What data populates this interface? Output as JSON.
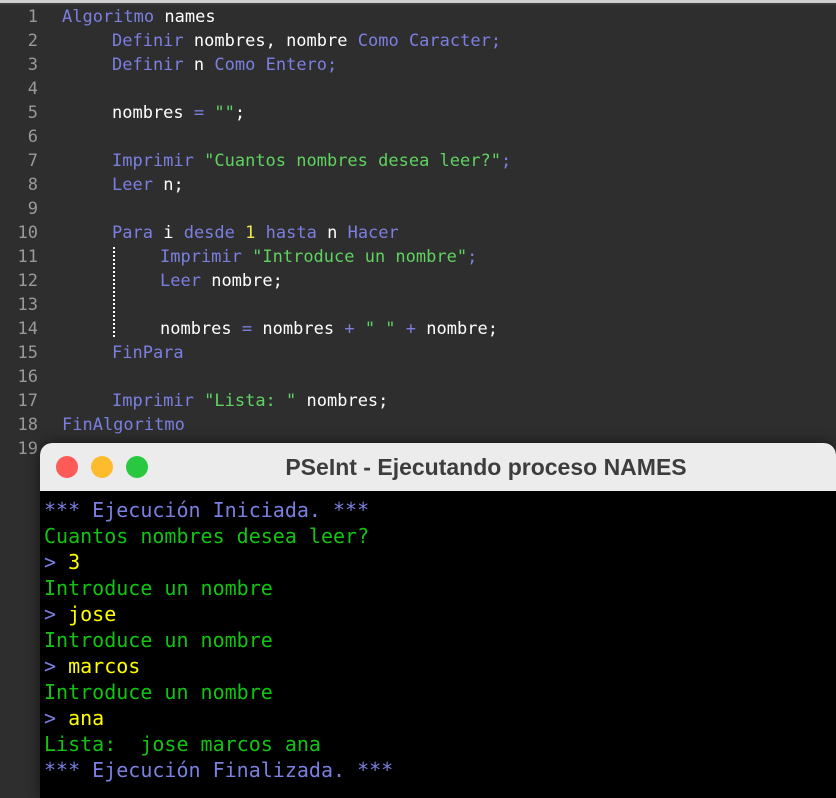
{
  "editor": {
    "name": "pseint-code-editor",
    "language": "PSeInt",
    "line_count_visible": 19,
    "lines": [
      {
        "n": "1",
        "tokens": [
          {
            "t": "Algoritmo",
            "c": "kw"
          },
          {
            "t": " ",
            "c": "id"
          },
          {
            "t": "names",
            "c": "id"
          }
        ],
        "indent": 0
      },
      {
        "n": "2",
        "tokens": [
          {
            "t": "Definir",
            "c": "kw"
          },
          {
            "t": " ",
            "c": "id"
          },
          {
            "t": "nombres",
            "c": "id"
          },
          {
            "t": ",",
            "c": "id"
          },
          {
            "t": " ",
            "c": "id"
          },
          {
            "t": "nombre",
            "c": "id"
          },
          {
            "t": " ",
            "c": "id"
          },
          {
            "t": "Como",
            "c": "kw"
          },
          {
            "t": " ",
            "c": "id"
          },
          {
            "t": "Caracter",
            "c": "kw"
          },
          {
            "t": ";",
            "c": "kw"
          }
        ],
        "indent": 1
      },
      {
        "n": "3",
        "tokens": [
          {
            "t": "Definir",
            "c": "kw"
          },
          {
            "t": " ",
            "c": "id"
          },
          {
            "t": "n",
            "c": "id"
          },
          {
            "t": " ",
            "c": "id"
          },
          {
            "t": "Como",
            "c": "kw"
          },
          {
            "t": " ",
            "c": "id"
          },
          {
            "t": "Entero",
            "c": "kw"
          },
          {
            "t": ";",
            "c": "kw"
          }
        ],
        "indent": 1
      },
      {
        "n": "4",
        "tokens": [],
        "indent": 1
      },
      {
        "n": "5",
        "tokens": [
          {
            "t": "nombres",
            "c": "id"
          },
          {
            "t": " ",
            "c": "id"
          },
          {
            "t": "=",
            "c": "op"
          },
          {
            "t": " ",
            "c": "id"
          },
          {
            "t": "\"\"",
            "c": "str"
          },
          {
            "t": ";",
            "c": "id"
          }
        ],
        "indent": 1
      },
      {
        "n": "6",
        "tokens": [],
        "indent": 1
      },
      {
        "n": "7",
        "tokens": [
          {
            "t": "Imprimir",
            "c": "kw"
          },
          {
            "t": " ",
            "c": "id"
          },
          {
            "t": "\"Cuantos nombres desea leer?\"",
            "c": "str"
          },
          {
            "t": ";",
            "c": "kw"
          }
        ],
        "indent": 1
      },
      {
        "n": "8",
        "tokens": [
          {
            "t": "Leer",
            "c": "kw"
          },
          {
            "t": " ",
            "c": "id"
          },
          {
            "t": "n",
            "c": "id"
          },
          {
            "t": ";",
            "c": "id"
          }
        ],
        "indent": 1
      },
      {
        "n": "9",
        "tokens": [],
        "indent": 1
      },
      {
        "n": "10",
        "tokens": [
          {
            "t": "Para",
            "c": "kw"
          },
          {
            "t": " ",
            "c": "id"
          },
          {
            "t": "i",
            "c": "id"
          },
          {
            "t": " ",
            "c": "id"
          },
          {
            "t": "desde",
            "c": "kw"
          },
          {
            "t": " ",
            "c": "id"
          },
          {
            "t": "1",
            "c": "num"
          },
          {
            "t": " ",
            "c": "id"
          },
          {
            "t": "hasta",
            "c": "kw"
          },
          {
            "t": " ",
            "c": "id"
          },
          {
            "t": "n",
            "c": "id"
          },
          {
            "t": " ",
            "c": "id"
          },
          {
            "t": "Hacer",
            "c": "kw"
          }
        ],
        "indent": 1
      },
      {
        "n": "11",
        "tokens": [
          {
            "t": "Imprimir",
            "c": "kw"
          },
          {
            "t": " ",
            "c": "id"
          },
          {
            "t": "\"Introduce un nombre\"",
            "c": "str"
          },
          {
            "t": ";",
            "c": "kw"
          }
        ],
        "indent": 2
      },
      {
        "n": "12",
        "tokens": [
          {
            "t": "Leer",
            "c": "kw"
          },
          {
            "t": " ",
            "c": "id"
          },
          {
            "t": "nombre",
            "c": "id"
          },
          {
            "t": ";",
            "c": "id"
          }
        ],
        "indent": 2
      },
      {
        "n": "13",
        "tokens": [],
        "indent": 2
      },
      {
        "n": "14",
        "tokens": [
          {
            "t": "nombres",
            "c": "id"
          },
          {
            "t": " ",
            "c": "id"
          },
          {
            "t": "=",
            "c": "op"
          },
          {
            "t": " ",
            "c": "id"
          },
          {
            "t": "nombres",
            "c": "id"
          },
          {
            "t": " ",
            "c": "id"
          },
          {
            "t": "+",
            "c": "op"
          },
          {
            "t": " ",
            "c": "id"
          },
          {
            "t": "\" \"",
            "c": "str"
          },
          {
            "t": " ",
            "c": "id"
          },
          {
            "t": "+",
            "c": "op"
          },
          {
            "t": " ",
            "c": "id"
          },
          {
            "t": "nombre",
            "c": "id"
          },
          {
            "t": ";",
            "c": "id"
          }
        ],
        "indent": 2
      },
      {
        "n": "15",
        "tokens": [
          {
            "t": "FinPara",
            "c": "kw"
          }
        ],
        "indent": 1
      },
      {
        "n": "16",
        "tokens": [],
        "indent": 1
      },
      {
        "n": "17",
        "tokens": [
          {
            "t": "Imprimir",
            "c": "kw"
          },
          {
            "t": " ",
            "c": "id"
          },
          {
            "t": "\"Lista: \"",
            "c": "str"
          },
          {
            "t": " ",
            "c": "id"
          },
          {
            "t": "nombres",
            "c": "id"
          },
          {
            "t": ";",
            "c": "id"
          }
        ],
        "indent": 1
      },
      {
        "n": "18",
        "tokens": [
          {
            "t": "FinAlgoritmo",
            "c": "kw"
          }
        ],
        "indent": 0
      },
      {
        "n": "19",
        "tokens": [],
        "indent": 0
      }
    ],
    "colors": {
      "background": "#2e2e2e",
      "line_number": "#9a9a9a",
      "keyword": "#7b7fe0",
      "string": "#5fd35f",
      "number": "#f2e750",
      "identifier": "#ffffff",
      "indent_guide": "#ffffff"
    }
  },
  "console_window": {
    "title": "PSeInt - Ejecutando proceso NAMES",
    "titlebar_background": "#ececec",
    "titlebar_text_color": "#3d3d3d",
    "traffic_lights": [
      {
        "name": "close-button",
        "color": "#fc5b57",
        "label": "close"
      },
      {
        "name": "minimize-button",
        "color": "#fdbc2e",
        "label": "minimize"
      },
      {
        "name": "maximize-button",
        "color": "#28c840",
        "label": "maximize"
      }
    ],
    "body_background": "#000000",
    "colors": {
      "system_message": "#7b7fe0",
      "program_output": "#11c411",
      "prompt": "#7b7fe0",
      "user_input": "#ffff00"
    },
    "lines": [
      {
        "kind": "sys",
        "text": "*** Ejecución Iniciada. ***"
      },
      {
        "kind": "out",
        "text": "Cuantos nombres desea leer?"
      },
      {
        "kind": "input",
        "prompt": "> ",
        "value": "3"
      },
      {
        "kind": "out",
        "text": "Introduce un nombre"
      },
      {
        "kind": "input",
        "prompt": "> ",
        "value": "jose"
      },
      {
        "kind": "out",
        "text": "Introduce un nombre"
      },
      {
        "kind": "input",
        "prompt": "> ",
        "value": "marcos"
      },
      {
        "kind": "out",
        "text": "Introduce un nombre"
      },
      {
        "kind": "input",
        "prompt": "> ",
        "value": "ana"
      },
      {
        "kind": "out",
        "text": "Lista:  jose marcos ana"
      },
      {
        "kind": "sys",
        "text": "*** Ejecución Finalizada. ***"
      }
    ]
  }
}
